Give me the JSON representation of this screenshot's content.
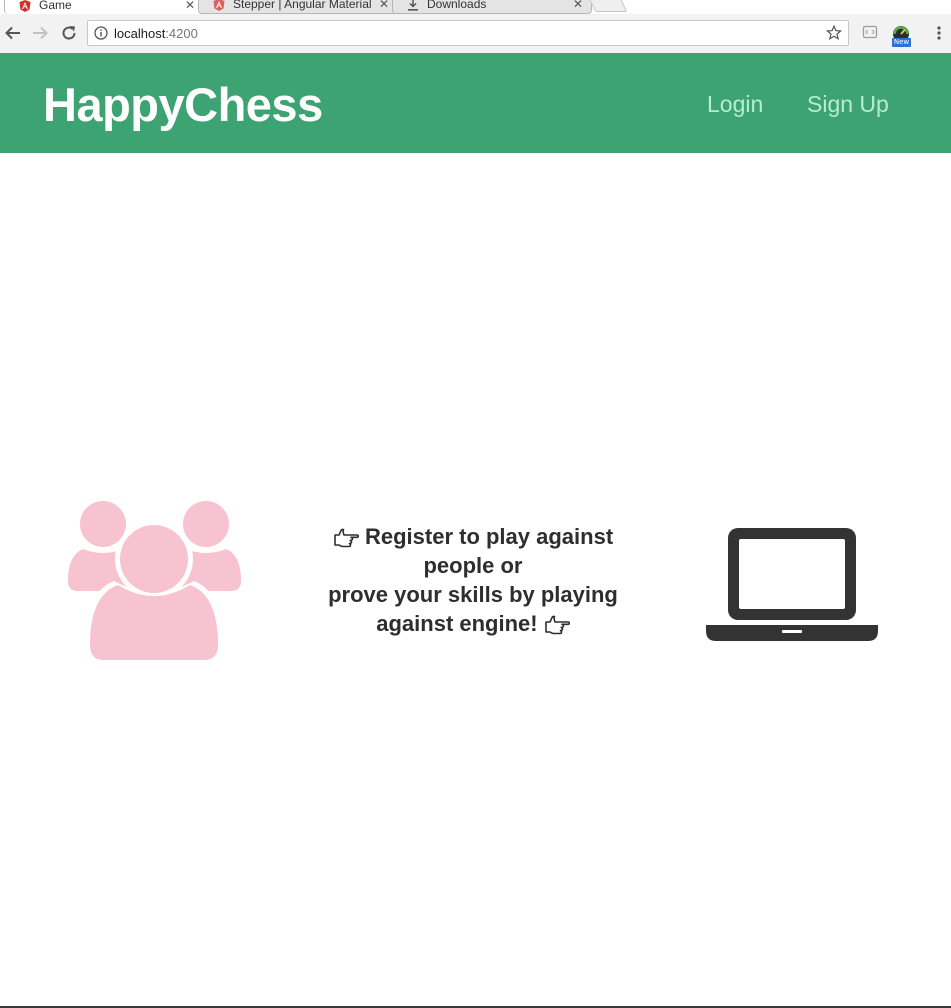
{
  "browser": {
    "tabs": [
      {
        "title": "Game",
        "icon": "angular-icon",
        "active": true
      },
      {
        "title": "Stepper | Angular Material",
        "icon": "angular-icon",
        "active": false
      },
      {
        "title": "Downloads",
        "icon": "download-icon",
        "active": false
      }
    ],
    "close_glyph": "✕",
    "url_host": "localhost",
    "url_port": ":4200",
    "extension_badge": "New"
  },
  "header": {
    "brand": "HappyChess",
    "nav": {
      "login": "Login",
      "signup": "Sign Up"
    }
  },
  "hero": {
    "line1": "Register to play against",
    "line2": "people or",
    "line3": "prove your skills by playing",
    "line4": "against engine!",
    "left_icon": "people-group-icon",
    "right_icon": "laptop-icon",
    "pointer_icon": "pointing-hand-icon"
  },
  "colors": {
    "header_bg": "#3ea372",
    "brand_text": "#ffffff",
    "nav_link": "#b6ecd2",
    "people_icon": "#f8c3d0",
    "laptop_icon": "#333333",
    "hero_text": "#2e2e2e"
  }
}
